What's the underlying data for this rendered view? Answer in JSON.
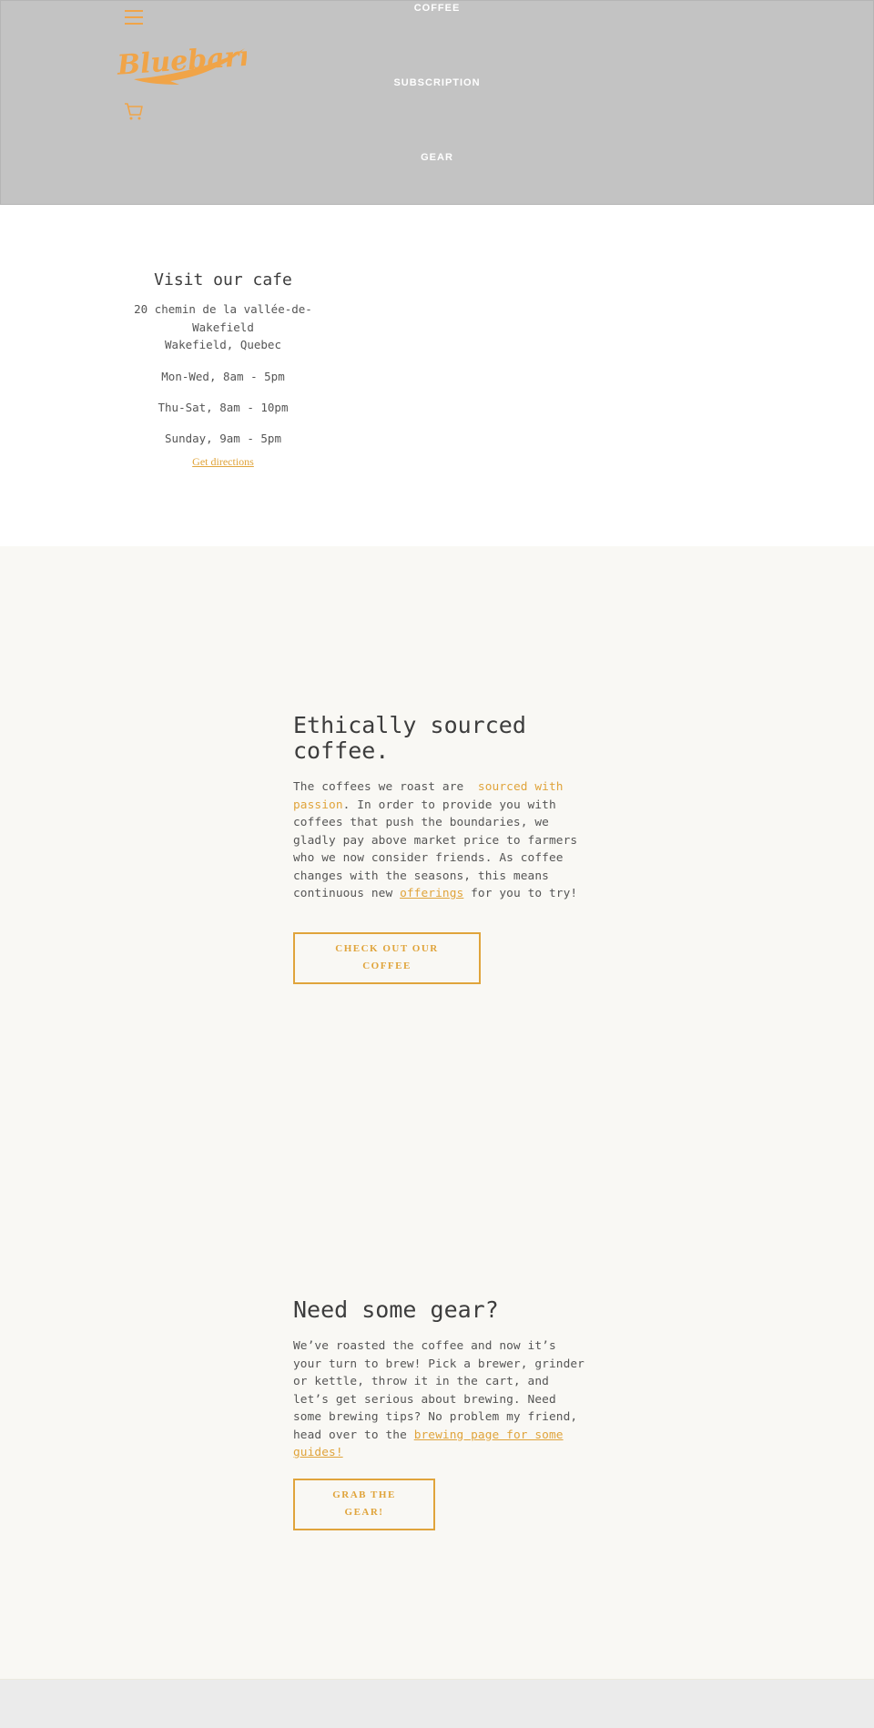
{
  "header": {
    "brand": "Bluebarn",
    "nav": [
      {
        "label": "COFFEE"
      },
      {
        "label": "SUBSCRIPTION"
      },
      {
        "label": "GEAR"
      }
    ],
    "icons": {
      "menu": "hamburger-icon",
      "cart": "cart-icon"
    },
    "accent_color": "#f0a448"
  },
  "cafe": {
    "title": "Visit our cafe",
    "address_line1": "20 chemin de la vallée-de-Wakefield",
    "address_line2": "Wakefield, Quebec",
    "hours": [
      "Mon-Wed, 8am - 5pm",
      "Thu-Sat, 8am - 10pm",
      "Sunday, 9am - 5pm"
    ],
    "directions_label": "Get directions"
  },
  "ethical": {
    "title": "Ethically sourced coffee.",
    "text_before": "The coffees we roast are ",
    "link1": "sourced with passion",
    "text_middle": ". In order to provide you with coffees that push the boundaries, we gladly pay above market price to farmers who we now consider friends. As coffee changes with the seasons, this means continuous new ",
    "link2": "offerings",
    "text_after": " for you to try!",
    "button_label": "CHECK OUT OUR COFFEE"
  },
  "gear": {
    "title": "Need some gear?",
    "text_before": "We’ve roasted the coffee and now it’s your turn to brew! Pick a brewer, grinder or kettle, throw it in the cart, and let’s get serious about brewing. Need some brewing tips? No problem my friend, head over to the ",
    "link": "brewing page for some guides! ",
    "button_label": "GRAB THE GEAR!"
  },
  "colors": {
    "accent": "#e0a43b",
    "header_bg": "#c3c3c3",
    "section_bg": "#f9f8f4",
    "footer_bg": "#ebebeb"
  }
}
